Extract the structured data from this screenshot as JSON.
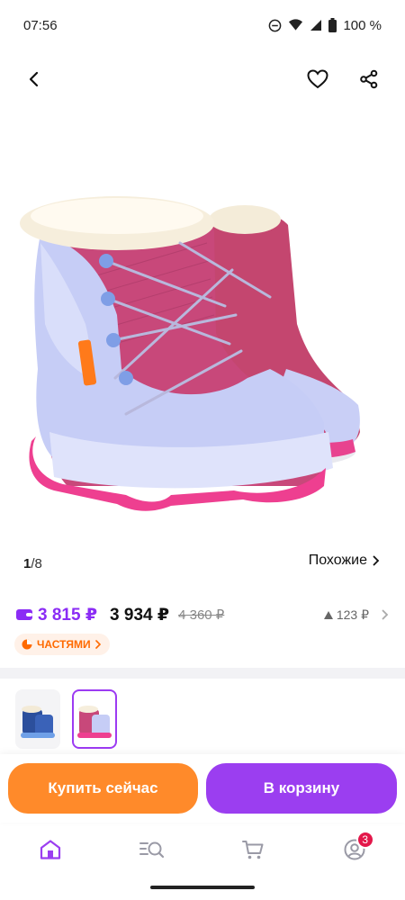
{
  "status_bar": {
    "time": "07:56",
    "battery": "100 %"
  },
  "gallery": {
    "current": "1",
    "separator": "/",
    "total": "8",
    "similar_label": "Похожие"
  },
  "price": {
    "card_price": "3 815 ₽",
    "regular_price": "3 934 ₽",
    "old_price": "4 360 ₽",
    "change": "123 ₽"
  },
  "installment": {
    "label": "ЧАСТЯМИ"
  },
  "actions": {
    "buy_now": "Купить сейчас",
    "add_to_cart": "В корзину"
  },
  "bottom_nav": {
    "profile_badge": "3"
  },
  "colors": {
    "accent_purple": "#9b3ef0",
    "orange": "#ff8a2a",
    "price_purple": "#8b2cf5"
  },
  "icons": [
    "back-arrow-icon",
    "heart-icon",
    "share-icon",
    "home-icon",
    "catalog-search-icon",
    "cart-icon",
    "profile-icon",
    "wallet-icon",
    "installment-icon"
  ]
}
